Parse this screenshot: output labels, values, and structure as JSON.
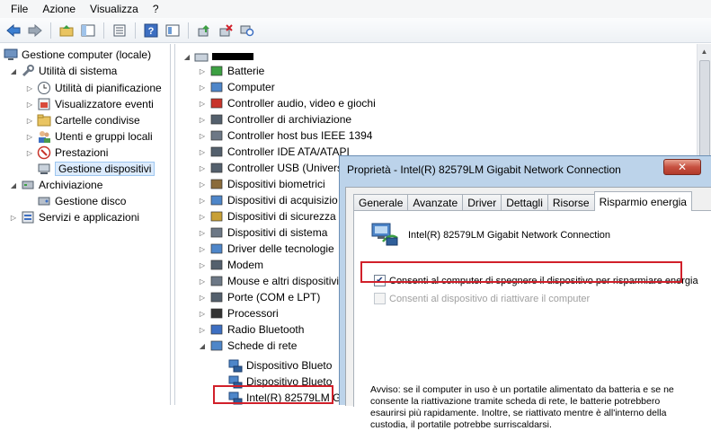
{
  "menubar": {
    "items": [
      "File",
      "Azione",
      "Visualizza",
      "?"
    ]
  },
  "left_tree": {
    "root": "Gestione computer (locale)",
    "system_tools": "Utilità di sistema",
    "items": [
      "Utilità di pianificazione",
      "Visualizzatore eventi",
      "Cartelle condivise",
      "Utenti e gruppi locali",
      "Prestazioni",
      "Gestione dispositivi"
    ],
    "storage": "Archiviazione",
    "disk": "Gestione disco",
    "services": "Servizi e applicazioni"
  },
  "device_tree": {
    "categories": [
      "Batterie",
      "Computer",
      "Controller audio, video e giochi",
      "Controller di archiviazione",
      "Controller host bus IEEE 1394",
      "Controller IDE ATA/ATAPI",
      "Controller USB (Univers",
      "Dispositivi biometrici",
      "Dispositivi di acquisizio",
      "Dispositivi di sicurezza",
      "Dispositivi di sistema",
      "Driver delle tecnologie",
      "Modem",
      "Mouse e altri dispositivi",
      "Porte (COM e LPT)",
      "Processori",
      "Radio Bluetooth",
      "Schede di rete"
    ],
    "network_children": [
      "Dispositivo Blueto",
      "Dispositivo Blueto",
      "Intel(R) 82579LM Gi"
    ]
  },
  "dialog": {
    "title": "Proprietà - Intel(R) 82579LM Gigabit Network Connection",
    "close_label": "✕",
    "tabs": [
      "Generale",
      "Avanzate",
      "Driver",
      "Dettagli",
      "Risorse",
      "Risparmio energia"
    ],
    "device_name": "Intel(R) 82579LM Gigabit Network Connection",
    "option1": "Consenti al computer di spegnere il dispositivo per risparmiare energia",
    "option2": "Consenti al dispositivo di riattivare il computer",
    "warning": "Avviso: se il computer in uso è un portatile alimentato da batteria e se ne consente la riattivazione tramite scheda di rete, le batterie potrebbero esaurirsi più rapidamente. Inoltre, se riattivato mentre è all'interno della custodia, il portatile potrebbe surriscaldarsi."
  },
  "colors": {
    "highlight": "#d1202a",
    "selection": "#dcebfc",
    "dialog_frame": "#bcd3ea"
  }
}
